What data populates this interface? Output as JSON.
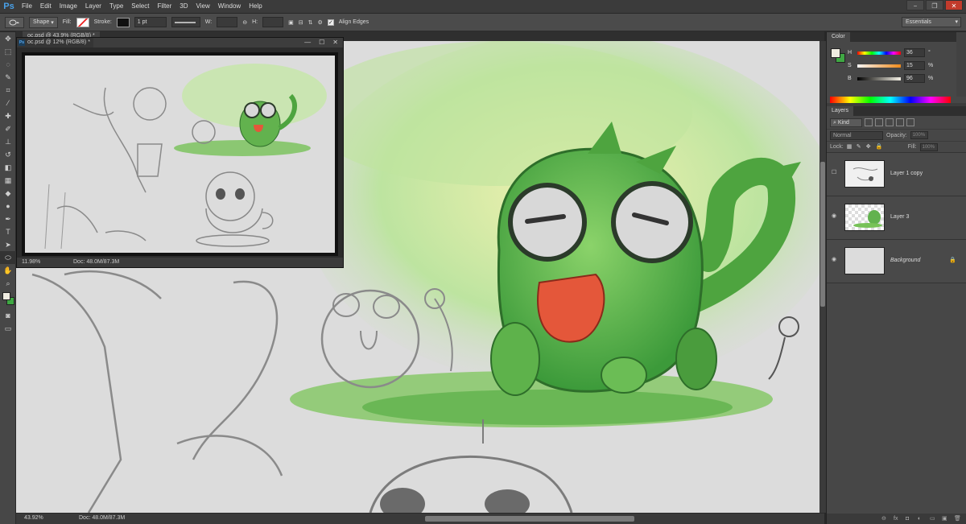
{
  "app": {
    "logo": "Ps",
    "menu": [
      "File",
      "Edit",
      "Image",
      "Layer",
      "Type",
      "Select",
      "Filter",
      "3D",
      "View",
      "Window",
      "Help"
    ],
    "window_controls": [
      "−",
      "❐",
      "✕"
    ]
  },
  "options_bar": {
    "mode": "Shape",
    "fill_label": "Fill:",
    "stroke_label": "Stroke:",
    "stroke_width": "1 pt",
    "w_label": "W:",
    "h_label": "H:",
    "align_edges_label": "Align Edges",
    "align_edges_checked": true,
    "workspace": "Essentials"
  },
  "document": {
    "tab_title": "oc.psd @ 43.9% (RGB/8) *",
    "zoom": "43.92%",
    "doc_size": "Doc: 48.0M/87.3M"
  },
  "floating_window": {
    "title": "oc.psd @ 12% (RGB/8) *",
    "zoom": "11.98%",
    "doc_size": "Doc: 48.0M/87.3M"
  },
  "colors": {
    "foreground": "#efece1",
    "background": "#3fa843",
    "accent_blue": "#49a0e8"
  },
  "color_panel": {
    "tab": "Color",
    "h": {
      "label": "H",
      "value": "36",
      "unit": "°"
    },
    "s": {
      "label": "S",
      "value": "15",
      "unit": "%"
    },
    "b": {
      "label": "B",
      "value": "96",
      "unit": "%"
    }
  },
  "layers_panel": {
    "tab": "Layers",
    "filter_kind": "Kind",
    "blend_mode": "Normal",
    "opacity_label": "Opacity:",
    "opacity_value": "100%",
    "lock_label": "Lock:",
    "fill_label": "Fill:",
    "fill_value": "100%",
    "layers": [
      {
        "name": "Layer 1 copy",
        "visible": false,
        "locked": false
      },
      {
        "name": "Layer 3",
        "visible": true,
        "locked": false
      },
      {
        "name": "Background",
        "visible": true,
        "locked": true
      }
    ]
  },
  "tools": [
    "move-tool",
    "marquee-tool",
    "lasso-tool",
    "quick-select-tool",
    "crop-tool",
    "eyedropper-tool",
    "healing-tool",
    "brush-tool",
    "clone-stamp-tool",
    "history-brush-tool",
    "eraser-tool",
    "gradient-tool",
    "blur-tool",
    "dodge-tool",
    "pen-tool",
    "type-tool",
    "path-select-tool",
    "ellipse-tool",
    "hand-tool",
    "zoom-tool"
  ]
}
